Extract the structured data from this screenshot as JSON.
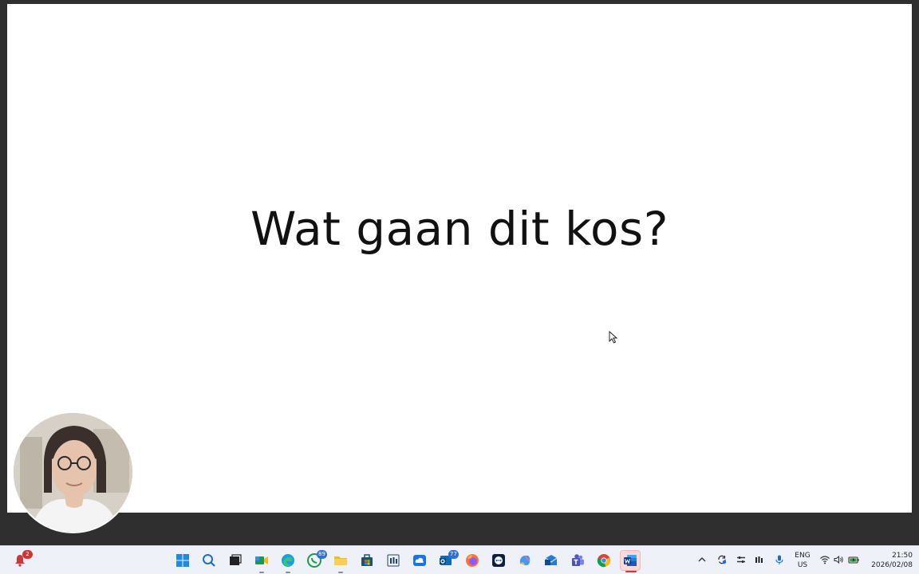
{
  "slide": {
    "title": "Wat gaan dit kos?"
  },
  "taskbar": {
    "notification_badge": "2",
    "apps": [
      {
        "name": "windows-start",
        "badge": ""
      },
      {
        "name": "search",
        "badge": ""
      },
      {
        "name": "task-view",
        "badge": ""
      },
      {
        "name": "meet",
        "badge": ""
      },
      {
        "name": "edge",
        "badge": ""
      },
      {
        "name": "whatsapp",
        "badge": "89"
      },
      {
        "name": "file-explorer",
        "badge": ""
      },
      {
        "name": "store",
        "badge": ""
      },
      {
        "name": "monitor-app",
        "badge": ""
      },
      {
        "name": "cloud",
        "badge": ""
      },
      {
        "name": "outlook",
        "badge": "77"
      },
      {
        "name": "firefox",
        "badge": ""
      },
      {
        "name": "teamviewer",
        "badge": ""
      },
      {
        "name": "copilot",
        "badge": ""
      },
      {
        "name": "outlook-new",
        "badge": ""
      },
      {
        "name": "teams",
        "badge": ""
      },
      {
        "name": "chrome",
        "badge": ""
      },
      {
        "name": "word",
        "badge": ""
      }
    ],
    "tray": {
      "language_line1": "ENG",
      "language_line2": "US",
      "time": "21:50",
      "date": "2026/02/08"
    }
  },
  "colors": {
    "slide_background": "#ffffff",
    "frame_background": "#2f2f2f",
    "taskbar_background": "#eef1f7",
    "badge_blue": "#2f6fd6",
    "badge_red": "#d13438"
  }
}
